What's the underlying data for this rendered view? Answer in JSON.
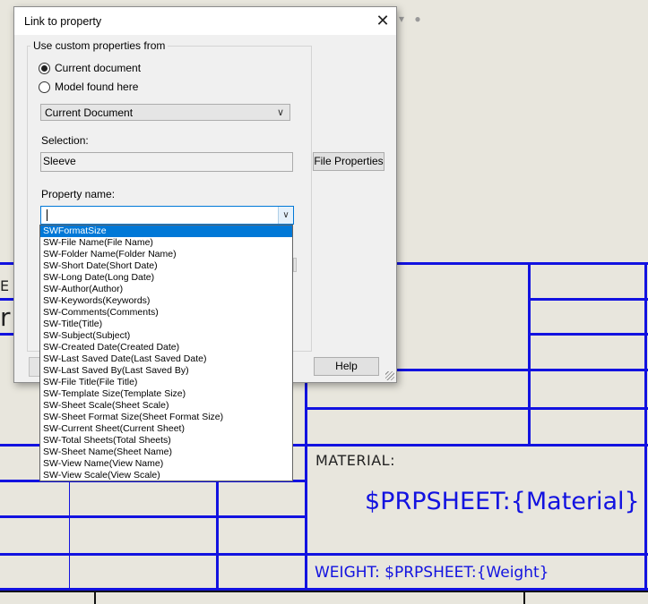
{
  "dialog": {
    "title": "Link to property",
    "group_label": "Use custom properties from",
    "radio_current": "Current document",
    "radio_model": "Model found here",
    "source_value": "Current Document",
    "selection_label": "Selection:",
    "selection_value": "Sleeve",
    "file_properties_label": "File Properties",
    "property_name_label": "Property name:",
    "property_value": "",
    "help_label": "Help"
  },
  "dropdown": {
    "items": [
      "SWFormatSize",
      "SW-File Name(File Name)",
      "SW-Folder Name(Folder Name)",
      "SW-Short Date(Short Date)",
      "SW-Long Date(Long Date)",
      "SW-Author(Author)",
      "SW-Keywords(Keywords)",
      "SW-Comments(Comments)",
      "SW-Title(Title)",
      "SW-Subject(Subject)",
      "SW-Created Date(Created Date)",
      "SW-Last Saved Date(Last Saved Date)",
      "SW-Last Saved By(Last Saved By)",
      "SW-File Title(File Title)",
      "SW-Template Size(Template Size)",
      "SW-Sheet Scale(Sheet Scale)",
      "SW-Sheet Format Size(Sheet Format Size)",
      "SW-Current Sheet(Current Sheet)",
      "SW-Total Sheets(Total Sheets)",
      "SW-Sheet Name(Sheet Name)",
      "SW-View Name(View Name)",
      "SW-View Scale(View Scale)"
    ],
    "selected_index": 0
  },
  "sheet": {
    "material_label": "MATERIAL:",
    "material_value": "$PRPSHEET:{Material}",
    "weight_label": "WEIGHT: $PRPSHEET:{Weight}",
    "title_fragment_1": "E",
    "title_fragment_2": "r",
    "line_color": "#1212e0",
    "background_color": "#e8e6dd"
  }
}
